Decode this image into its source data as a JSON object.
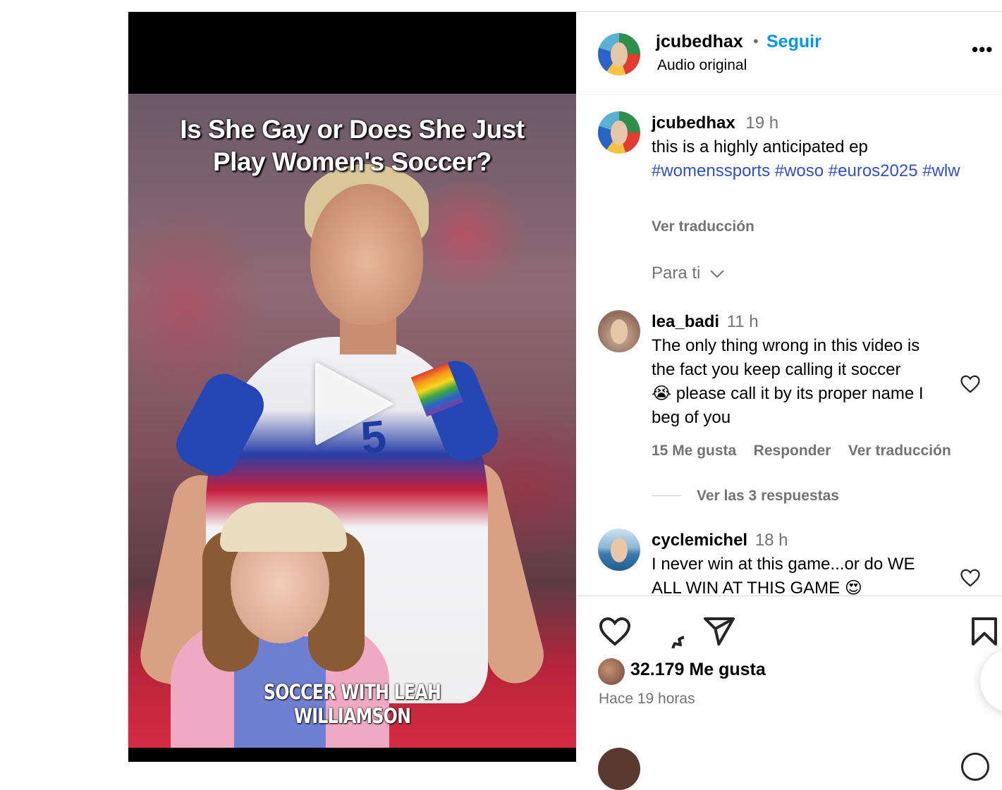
{
  "video": {
    "title_line1": "Is She Gay or Does She Just",
    "title_line2": "Play Women's Soccer?",
    "jersey_number": "5",
    "caption": "SOCCER WITH LEAH WILLIAMSON"
  },
  "header": {
    "username": "jcubedhax",
    "separator": "•",
    "follow_label": "Seguir",
    "subtitle": "Audio original",
    "more_label": "•••"
  },
  "caption_post": {
    "username": "jcubedhax",
    "time": "19 h",
    "text": "this is a highly anticipated ep",
    "hashtags": [
      "#womenssports",
      "#woso",
      "#euros2025",
      "#wlw"
    ],
    "translate": "Ver traducción"
  },
  "sort": {
    "label": "Para ti"
  },
  "comments": [
    {
      "username": "lea_badi",
      "time": "11 h",
      "line1": "The only thing wrong in this video is",
      "line2": "the fact you keep calling it soccer",
      "emoji": "😭",
      "line3": " please call it by its proper name I",
      "line4": "beg of you",
      "likes": "15 Me gusta",
      "reply": "Responder",
      "translate": "Ver traducción",
      "replies": "Ver las 3 respuestas"
    },
    {
      "username": "cyclemichel",
      "time": "18 h",
      "line1": "I never win at this game...or do WE",
      "line2": "ALL WIN AT THIS GAME ",
      "emoji": "😍"
    }
  ],
  "footer": {
    "likes": "32.179 Me gusta",
    "ago": "Hace 19 horas"
  },
  "colors": {
    "link": "#0095f6",
    "hashtag": "#2f4fcb",
    "muted": "#737373"
  }
}
